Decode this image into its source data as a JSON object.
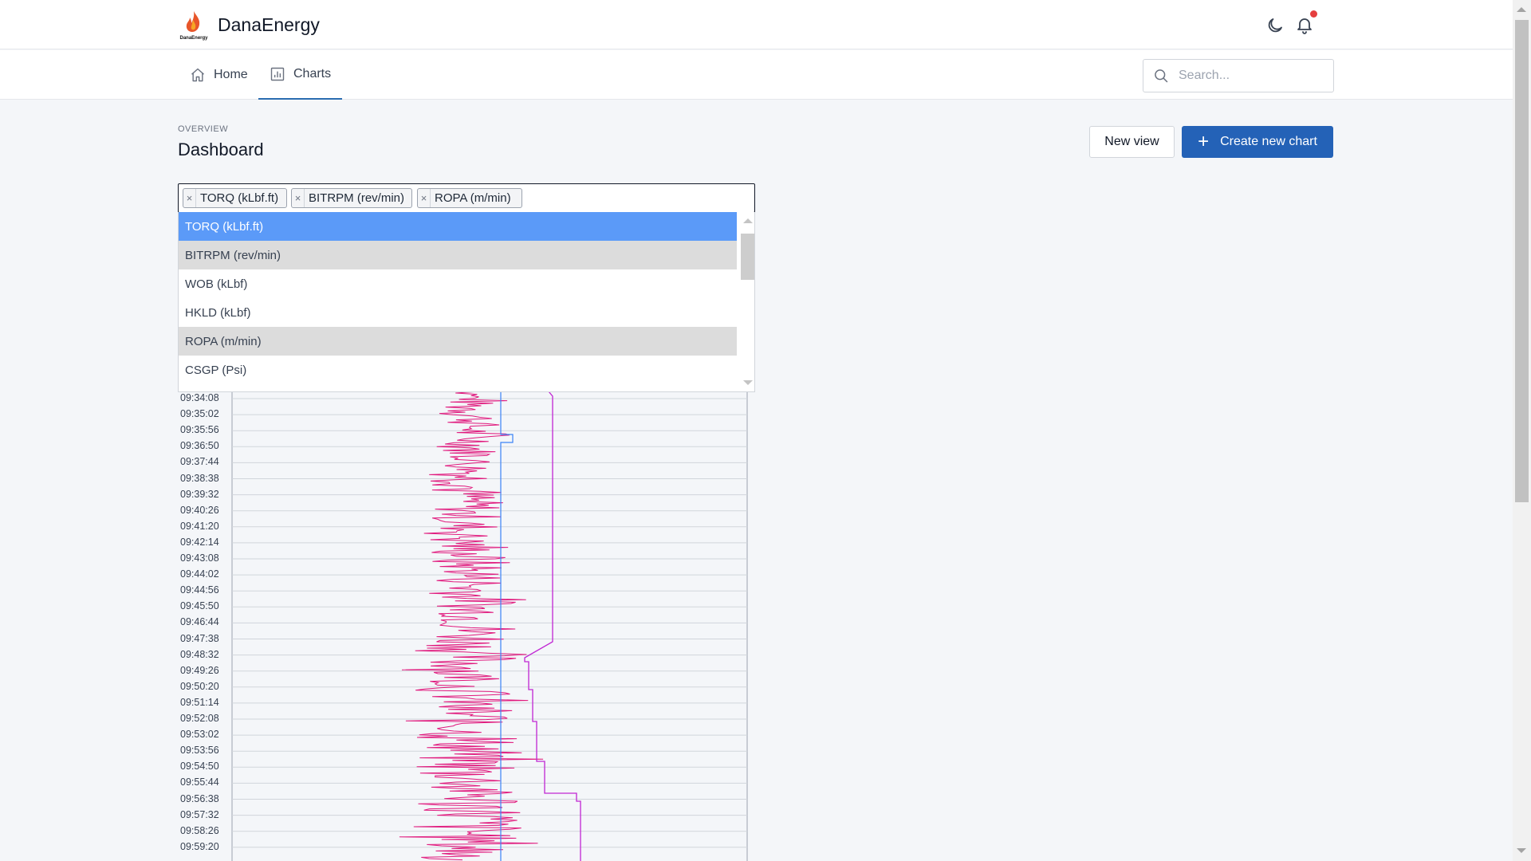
{
  "app": {
    "brand": "DanaEnergy",
    "logo_caption": "DanaEnergy"
  },
  "header": {
    "theme_icon": "moon-icon",
    "notification_icon": "bell-icon",
    "notification_dot_color": "#e53e3e"
  },
  "nav": {
    "items": [
      {
        "label": "Home",
        "icon": "home-icon",
        "active": false
      },
      {
        "label": "Charts",
        "icon": "bar-chart-icon",
        "active": true
      }
    ],
    "search_placeholder": "Search..."
  },
  "page": {
    "eyebrow": "OVERVIEW",
    "title": "Dashboard",
    "new_view_label": "New view",
    "create_label": "Create new chart",
    "accent_color": "#2462b7"
  },
  "selector": {
    "selected_tags": [
      "TORQ (kLbf.ft)",
      "BITRPM (rev/min)",
      "ROPA (m/min)"
    ],
    "options": [
      {
        "label": "TORQ (kLbf.ft)",
        "state": "highlighted"
      },
      {
        "label": "BITRPM (rev/min)",
        "state": "selected"
      },
      {
        "label": "WOB (kLbf)",
        "state": "none"
      },
      {
        "label": "HKLD (kLbf)",
        "state": "none"
      },
      {
        "label": "ROPA (m/min)",
        "state": "selected"
      },
      {
        "label": "CSGP (Psi)",
        "state": "none"
      }
    ]
  },
  "chart_data": {
    "type": "line",
    "orientation": "vertical-time",
    "y_tick_labels": [
      "09:34:08",
      "09:35:02",
      "09:35:56",
      "09:36:50",
      "09:37:44",
      "09:38:38",
      "09:39:32",
      "09:40:26",
      "09:41:20",
      "09:42:14",
      "09:43:08",
      "09:44:02",
      "09:44:56",
      "09:45:50",
      "09:46:44",
      "09:47:38",
      "09:48:32",
      "09:49:26",
      "09:50:20",
      "09:51:14",
      "09:52:08",
      "09:53:02",
      "09:53:56",
      "09:54:50",
      "09:55:44",
      "09:56:38",
      "09:57:32",
      "09:58:26",
      "09:59:20"
    ],
    "series_colors": {
      "dense": "#e0197d",
      "step_blue": "#3b82f6",
      "step_purple": "#c026d3"
    },
    "grid": true
  }
}
